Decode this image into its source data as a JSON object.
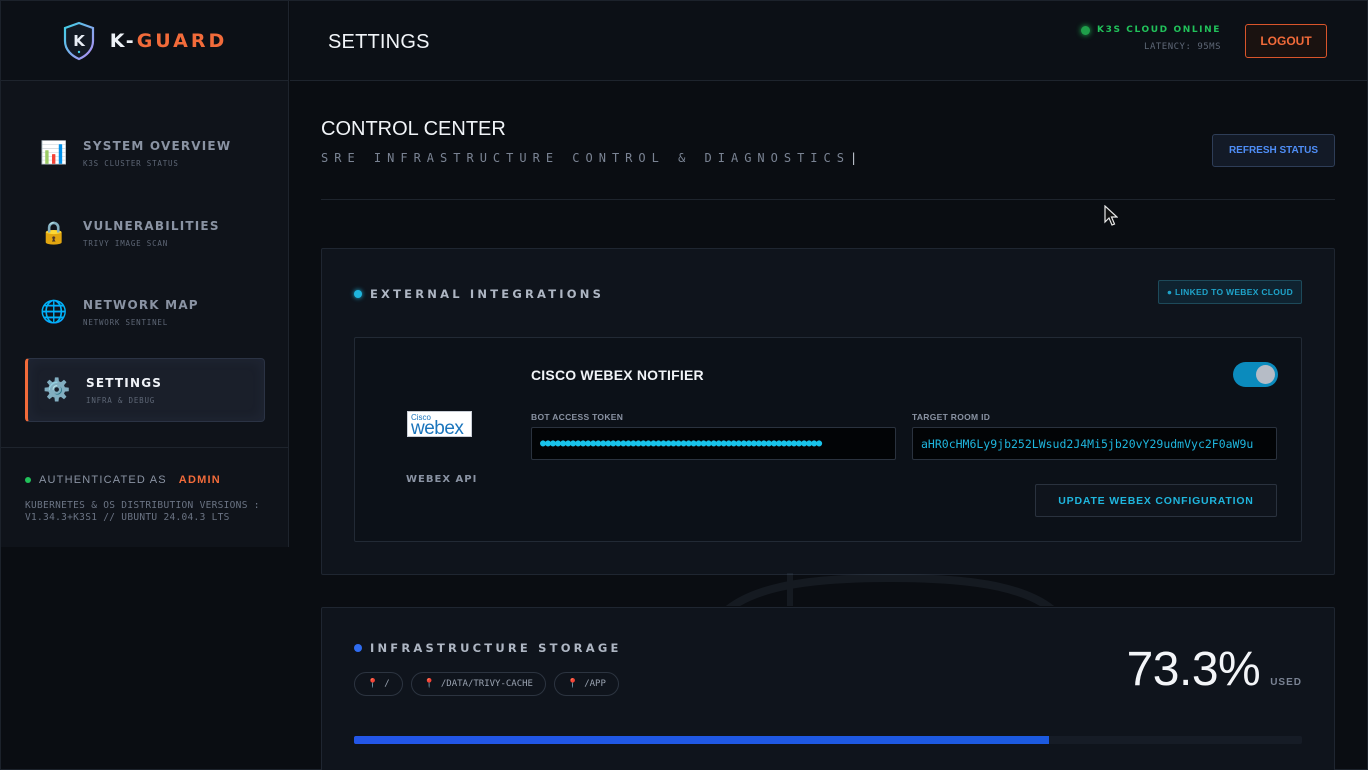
{
  "brand": {
    "prefix": "K-",
    "name": "GUARD",
    "shield_letter": "K"
  },
  "header": {
    "title": "SETTINGS",
    "status": "K3S CLOUD ONLINE",
    "latency": "LATENCY: 95MS",
    "logout_label": "LOGOUT"
  },
  "sidebar": {
    "items": [
      {
        "label": "SYSTEM OVERVIEW",
        "sub": "K3S CLUSTER STATUS",
        "icon": "chart-icon",
        "glyph": "📊",
        "active": false
      },
      {
        "label": "VULNERABILITIES",
        "sub": "TRIVY IMAGE SCAN",
        "icon": "lock-icon",
        "glyph": "🔒",
        "active": false
      },
      {
        "label": "NETWORK MAP",
        "sub": "NETWORK SENTINEL",
        "icon": "globe-icon",
        "glyph": "🌐",
        "active": false
      },
      {
        "label": "SETTINGS",
        "sub": "INFRA & DEBUG",
        "icon": "gear-icon",
        "glyph": "⚙️",
        "active": true
      }
    ],
    "footer": {
      "auth_prefix": "AUTHENTICATED AS",
      "user": "ADMIN",
      "versions_line1": "KUBERNETES & OS DISTRIBUTION VERSIONS :",
      "versions_line2": "V1.34.3+K3S1 // UBUNTU 24.04.3 LTS"
    }
  },
  "main": {
    "title": "CONTROL CENTER",
    "subtitle": "SRE INFRASTRUCTURE CONTROL & DIAGNOSTICS",
    "refresh_label": "REFRESH STATUS",
    "integrations": {
      "title": "EXTERNAL INTEGRATIONS",
      "badge": "● LINKED TO WEBEX CLOUD",
      "logo_small": "Cisco",
      "logo_big": "webex",
      "api_label": "WEBEX API",
      "notifier_title": "CISCO WEBEX NOTIFIER",
      "toggle_on": true,
      "token_label": "BOT ACCESS TOKEN",
      "token_value": "●●●●●●●●●●●●●●●●●●●●●●●●●●●●●●●●●●●●●●●●●●●●●●●●●●●●●●●●",
      "room_label": "TARGET ROOM ID",
      "room_value": "aHR0cHM6Ly9jb252LWsud2J4Mi5jb20vY29udmVyc2F0aW9u",
      "update_label": "UPDATE WEBEX CONFIGURATION"
    },
    "storage": {
      "title": "INFRASTRUCTURE STORAGE",
      "mounts": [
        "/",
        "/DATA/TRIVY-CACHE",
        "/APP"
      ],
      "percent_text": "73.3%",
      "percent_value": 73.3,
      "used_label": "USED"
    }
  },
  "colors": {
    "accent": "#f26b3a",
    "online": "#21c15a",
    "cyan": "#1fb6de",
    "blue": "#2356e8",
    "background": "#0a0d12"
  }
}
